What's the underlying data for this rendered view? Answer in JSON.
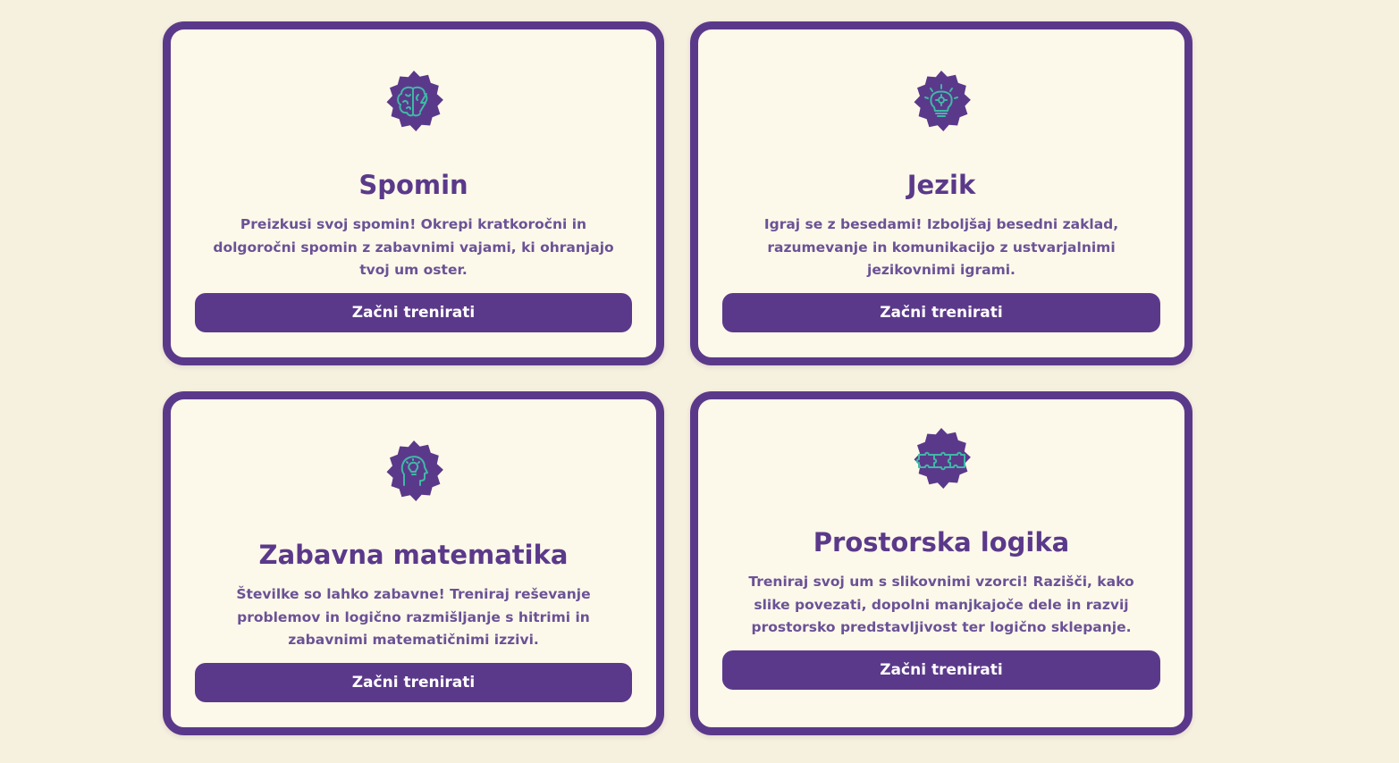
{
  "colors": {
    "page_background": "#f6f0de",
    "card_background": "#fdf9ea",
    "accent_purple": "#5b398a",
    "icon_teal": "#3fb8a6"
  },
  "cards": [
    {
      "title": "Spomin",
      "description": "Preizkusi svoj spomin! Okrepi kratkoročni in dolgoročni spomin z zabavnimi vajami, ki ohranjajo tvoj um oster.",
      "button_label": "Začni trenirati",
      "icon": "brain-lightning-icon"
    },
    {
      "title": "Jezik",
      "description": "Igraj se z besedami! Izboljšaj besedni zaklad, razumevanje in komunikacijo z ustvarjalnimi jezikovnimi igrami.",
      "button_label": "Začni trenirati",
      "icon": "lightbulb-gear-icon"
    },
    {
      "title": "Zabavna matematika",
      "description": "Številke so lahko zabavne! Treniraj reševanje problemov in logično razmišljanje s hitrimi in zabavnimi matematičnimi izzivi.",
      "button_label": "Začni trenirati",
      "icon": "head-lightbulb-icon"
    },
    {
      "title": "Prostorska logika",
      "description": "Treniraj svoj um s slikovnimi vzorci! Razišči, kako slike povezati, dopolni manjkajoče dele in razvij prostorsko predstavljivost ter logično sklepanje.",
      "button_label": "Začni trenirati",
      "icon": "puzzle-pieces-icon"
    }
  ]
}
